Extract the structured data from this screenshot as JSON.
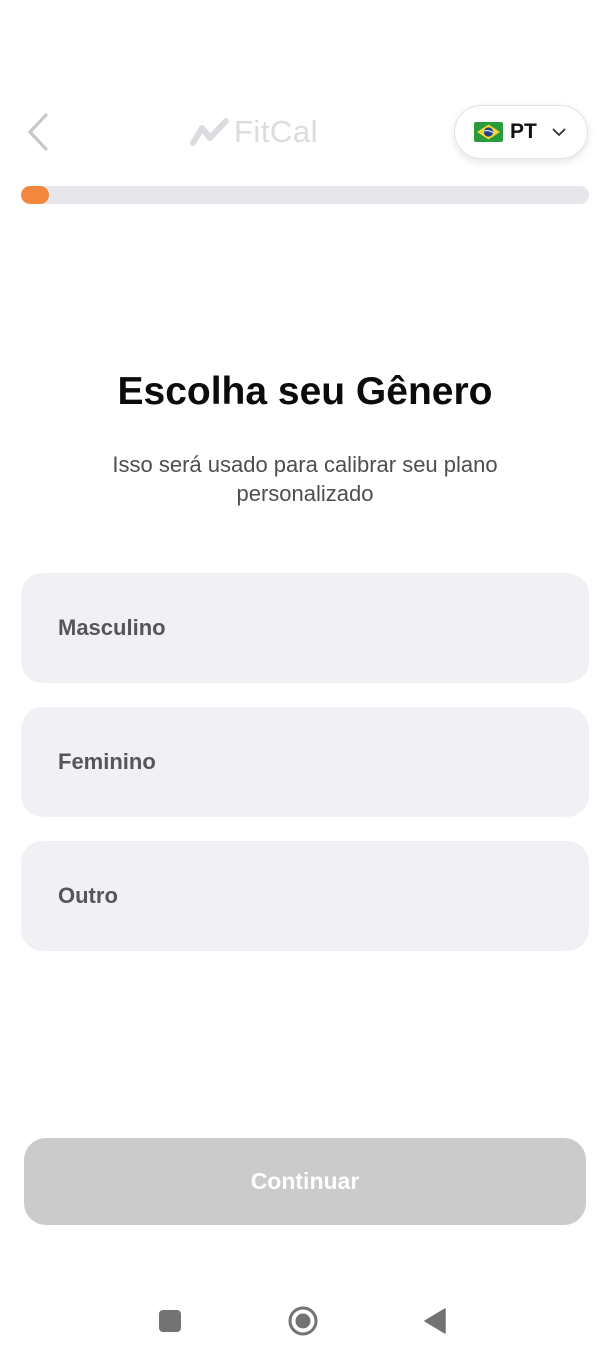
{
  "header": {
    "back_icon": "chevron-left-icon",
    "logo_text": "FitCal",
    "logo_icon": "trend-line-icon",
    "language": {
      "flag": "brazil-flag",
      "label": "PT",
      "icon": "chevron-down-icon"
    }
  },
  "progress": {
    "value_fraction": 0.05,
    "color": "#f2873d",
    "track_color": "#e6e6eb"
  },
  "main": {
    "title": "Escolha seu Gênero",
    "subtitle": "Isso será usado para calibrar seu plano personalizado",
    "options": [
      {
        "label": "Masculino"
      },
      {
        "label": "Feminino"
      },
      {
        "label": "Outro"
      }
    ],
    "continue_label": "Continuar"
  },
  "system_nav": {
    "recents_icon": "square-icon",
    "home_icon": "circle-home-icon",
    "back_icon": "triangle-back-icon"
  }
}
